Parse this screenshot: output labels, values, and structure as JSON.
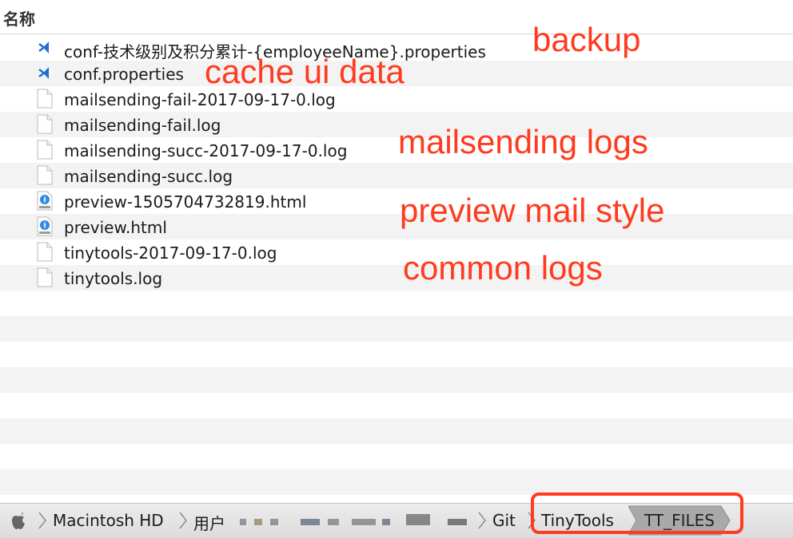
{
  "header": {
    "title": "名称"
  },
  "files": [
    {
      "name": "conf-技术级别及积分累计-{employeeName}.properties",
      "icon": "vscode-file-icon"
    },
    {
      "name": "conf.properties",
      "icon": "vscode-file-icon"
    },
    {
      "name": "mailsending-fail-2017-09-17-0.log",
      "icon": "document-icon"
    },
    {
      "name": "mailsending-fail.log",
      "icon": "document-icon"
    },
    {
      "name": "mailsending-succ-2017-09-17-0.log",
      "icon": "document-icon"
    },
    {
      "name": "mailsending-succ.log",
      "icon": "document-icon"
    },
    {
      "name": "preview-1505704732819.html",
      "icon": "html-file-icon"
    },
    {
      "name": "preview.html",
      "icon": "html-file-icon"
    },
    {
      "name": "tinytools-2017-09-17-0.log",
      "icon": "document-icon"
    },
    {
      "name": "tinytools.log",
      "icon": "document-icon"
    }
  ],
  "annotations": {
    "backup": "backup",
    "cache": "cache ui data",
    "mailsending": "mailsending logs",
    "preview": "preview mail style",
    "common": "common logs"
  },
  "pathbar": {
    "items": [
      "Macintosh HD",
      "用户",
      "Git",
      "TinyTools",
      "TT_FILES"
    ]
  },
  "colors": {
    "annotation": "#ff3b1f",
    "row_alt": "#f3f3f3"
  }
}
